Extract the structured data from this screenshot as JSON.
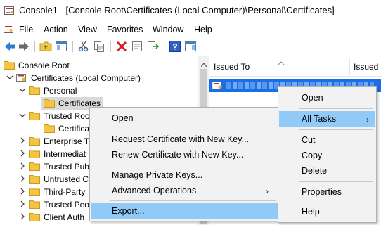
{
  "window": {
    "title": "Console1 - [Console Root\\Certificates (Local Computer)\\Personal\\Certificates]"
  },
  "menubar": {
    "items": [
      "File",
      "Action",
      "View",
      "Favorites",
      "Window",
      "Help"
    ]
  },
  "toolbar": {
    "buttons": [
      "back-arrow-icon",
      "forward-arrow-icon",
      "up-folder-icon",
      "show-hide-tree-icon",
      "cut-icon",
      "copy-icon",
      "delete-icon",
      "properties-icon",
      "export-list-icon",
      "help-icon",
      "action-pane-icon"
    ]
  },
  "tree": {
    "nodes": [
      {
        "label": "Console Root"
      },
      {
        "label": "Certificates (Local Computer)"
      },
      {
        "label": "Personal"
      },
      {
        "label": "Certificates"
      },
      {
        "label": "Trusted Roo"
      },
      {
        "label": "Certifica"
      },
      {
        "label": "Enterprise T"
      },
      {
        "label": "Intermediat"
      },
      {
        "label": "Trusted Pub"
      },
      {
        "label": "Untrusted C"
      },
      {
        "label": "Third-Party"
      },
      {
        "label": "Trusted Peo"
      },
      {
        "label": "Client Auth"
      }
    ]
  },
  "list": {
    "columns": [
      "Issued To",
      "Issued B"
    ]
  },
  "context_menu_main": {
    "items": [
      "Open",
      "All Tasks",
      "Cut",
      "Copy",
      "Delete",
      "Properties",
      "Help"
    ]
  },
  "context_menu_all_tasks": {
    "items": [
      "Open",
      "Request Certificate with New Key...",
      "Renew Certificate with New Key...",
      "Manage Private Keys...",
      "Advanced Operations",
      "Export..."
    ]
  },
  "colors": {
    "selection_blue": "#1c6ee6",
    "menu_highlight": "#91c9f7",
    "folder_yellow": "#f4c542"
  }
}
